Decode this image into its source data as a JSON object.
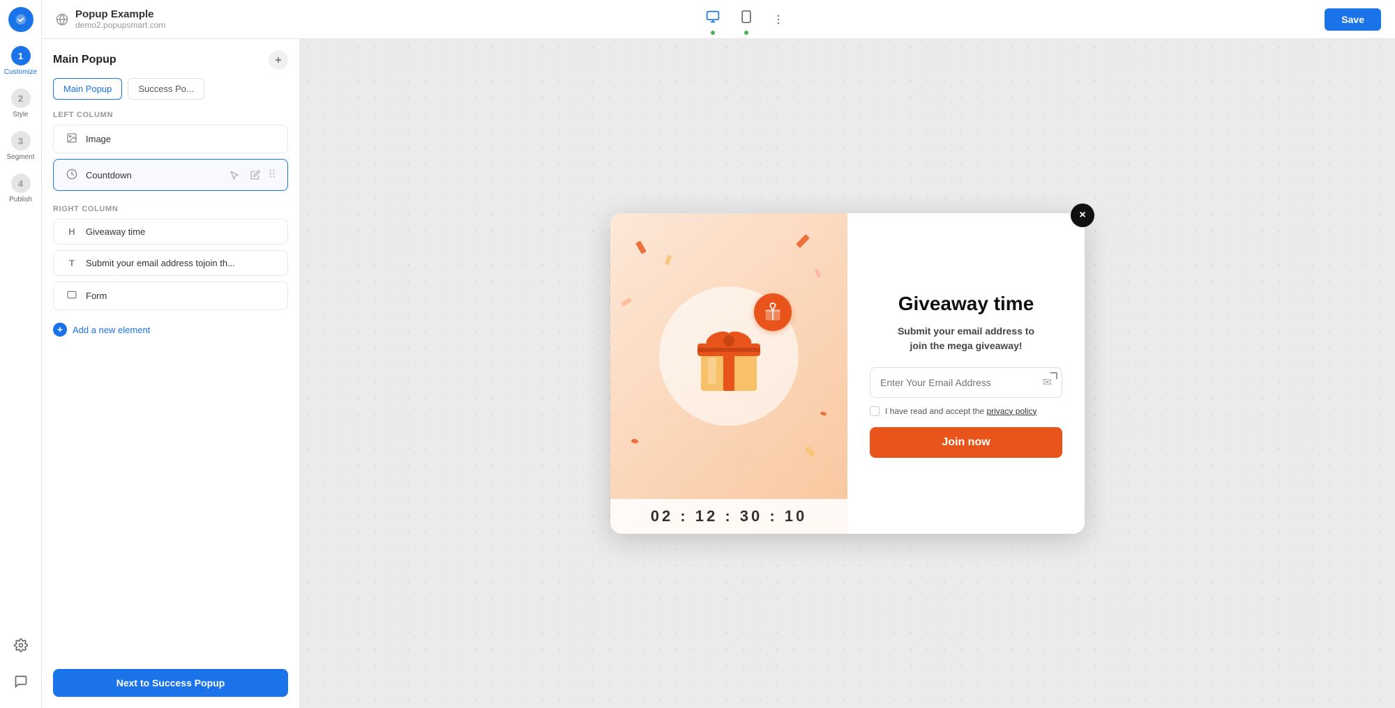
{
  "header": {
    "title": "Popup Example",
    "subtitle": "demo2.popupsmart.com",
    "save_label": "Save",
    "device_desktop_alt": "desktop",
    "device_mobile_alt": "mobile",
    "desktop_dot_color": "#4CAF50",
    "mobile_dot_color": "#4CAF50"
  },
  "sidebar": {
    "steps": [
      {
        "number": "1",
        "label": "Customize",
        "active": true
      },
      {
        "number": "2",
        "label": "Style",
        "active": false
      },
      {
        "number": "3",
        "label": "Segment",
        "active": false
      },
      {
        "number": "4",
        "label": "Publish",
        "active": false
      }
    ]
  },
  "panel": {
    "title": "Main Popup",
    "tabs": [
      {
        "label": "Main Popup",
        "active": true
      },
      {
        "label": "Success Po...",
        "active": false
      }
    ],
    "left_column_label": "LEFT COLUMN",
    "left_elements": [
      {
        "icon": "image",
        "label": "Image"
      },
      {
        "icon": "clock",
        "label": "Countdown",
        "selected": true
      }
    ],
    "right_column_label": "RIGHT COLUMN",
    "right_elements": [
      {
        "icon": "heading",
        "label": "Giveaway time"
      },
      {
        "icon": "text",
        "label": "Submit your email address tojoin th..."
      },
      {
        "icon": "form",
        "label": "Form"
      }
    ],
    "add_element_label": "Add a new element",
    "next_button_label": "Next to Success Popup"
  },
  "popup": {
    "close_btn_label": "×",
    "title": "Giveaway time",
    "subtitle_line1": "Submit your email address to",
    "subtitle_line2": "join the mega giveaway!",
    "email_placeholder": "Enter Your Email Address",
    "checkbox_label": "I have read and accept the",
    "privacy_policy_label": "privacy policy",
    "join_btn_label": "Join now",
    "countdown": "02 : 12 : 30 : 10"
  },
  "icons": {
    "search": "🔍",
    "kebab": "⋮",
    "plus": "+",
    "edit": "✎",
    "drag": "⠿",
    "mail": "✉",
    "image_icon": "▣",
    "clock_icon": "🕐",
    "heading_icon": "H",
    "text_icon": "T",
    "form_icon": "▭"
  }
}
